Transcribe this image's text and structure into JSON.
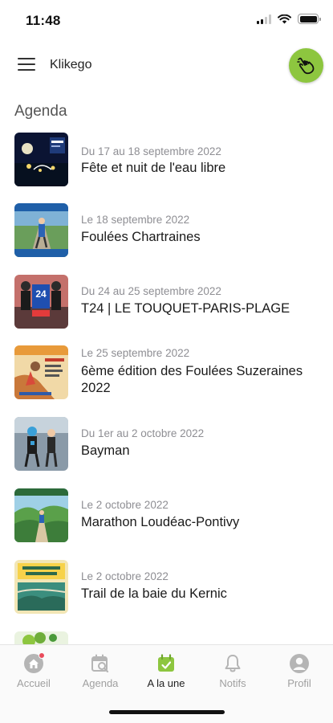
{
  "status_bar": {
    "time": "11:48"
  },
  "header": {
    "title": "Klikego"
  },
  "agenda": {
    "title": "Agenda",
    "events": [
      {
        "date": "Du 17 au 18 septembre 2022",
        "name": "Fête et nuit de l'eau libre"
      },
      {
        "date": "Le 18 septembre 2022",
        "name": "Foulées Chartraines"
      },
      {
        "date": "Du 24 au 25 septembre 2022",
        "name": "T24 | LE TOUQUET-PARIS-PLAGE"
      },
      {
        "date": "Le 25 septembre 2022",
        "name": "6ème édition des Foulées Suzeraines 2022"
      },
      {
        "date": "Du 1er au 2 octobre 2022",
        "name": "Bayman"
      },
      {
        "date": "Le 2 octobre 2022",
        "name": "Marathon Loudéac-Pontivy"
      },
      {
        "date": "Le 2 octobre 2022",
        "name": " Trail de la baie du Kernic"
      }
    ]
  },
  "tab_bar": {
    "tabs": [
      {
        "label": "Accueil",
        "icon": "home-icon",
        "has_badge": true
      },
      {
        "label": "Agenda",
        "icon": "calendar-search-icon"
      },
      {
        "label": "A la une",
        "icon": "calendar-check-icon",
        "active": true
      },
      {
        "label": "Notifs",
        "icon": "bell-icon"
      },
      {
        "label": "Profil",
        "icon": "user-circle-icon"
      }
    ]
  },
  "colors": {
    "accent": "#8dc63f",
    "badge": "#e94b5b",
    "inactive_tab": "#a0a0a0"
  }
}
